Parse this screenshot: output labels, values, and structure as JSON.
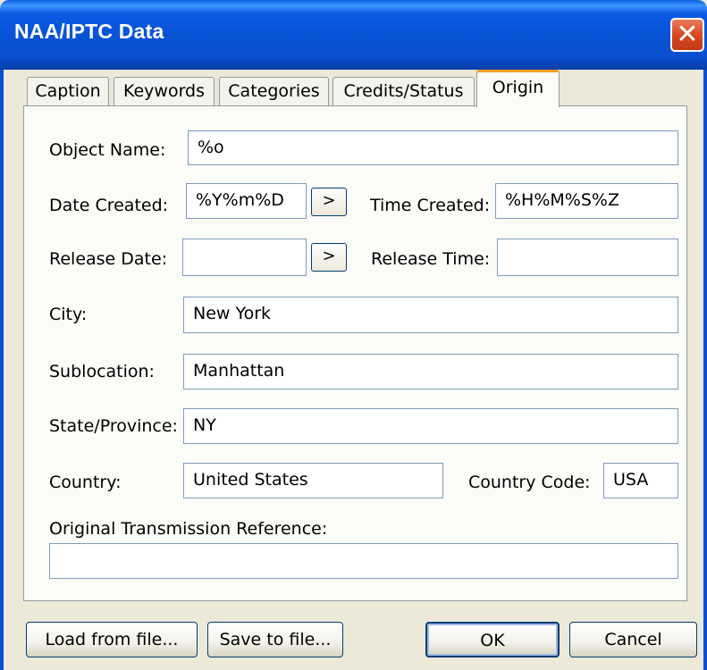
{
  "window": {
    "title": "NAA/IPTC Data",
    "close_glyph": "✕"
  },
  "tabs": [
    {
      "label": "Caption",
      "active": false
    },
    {
      "label": "Keywords",
      "active": false
    },
    {
      "label": "Categories",
      "active": false
    },
    {
      "label": "Credits/Status",
      "active": false
    },
    {
      "label": "Origin",
      "active": true
    }
  ],
  "origin": {
    "object_name": {
      "label": "Object Name:",
      "value": "%o"
    },
    "date_created": {
      "label": "Date Created:",
      "value": "%Y%m%D"
    },
    "time_created": {
      "label": "Time Created:",
      "value": "%H%M%S%Z"
    },
    "release_date": {
      "label": "Release Date:",
      "value": ""
    },
    "release_time": {
      "label": "Release Time:",
      "value": ""
    },
    "city": {
      "label": "City:",
      "value": "New York"
    },
    "sublocation": {
      "label": "Sublocation:",
      "value": "Manhattan"
    },
    "state_province": {
      "label": "State/Province:",
      "value": "NY"
    },
    "country": {
      "label": "Country:",
      "value": "United States"
    },
    "country_code": {
      "label": "Country Code:",
      "value": "USA"
    },
    "original_transmission_reference": {
      "label": "Original Transmission Reference:",
      "value": ""
    },
    "date_picker_label": ">"
  },
  "buttons": {
    "load_from_file": "Load from file...",
    "save_to_file": "Save to file...",
    "ok": "OK",
    "cancel": "Cancel"
  },
  "colors": {
    "titlebar": "#0a54d8",
    "window_bg": "#ece9d8",
    "panel_bg": "#fbfbf8",
    "active_tab_accent": "#f0a020",
    "close_button": "#d6451f"
  }
}
